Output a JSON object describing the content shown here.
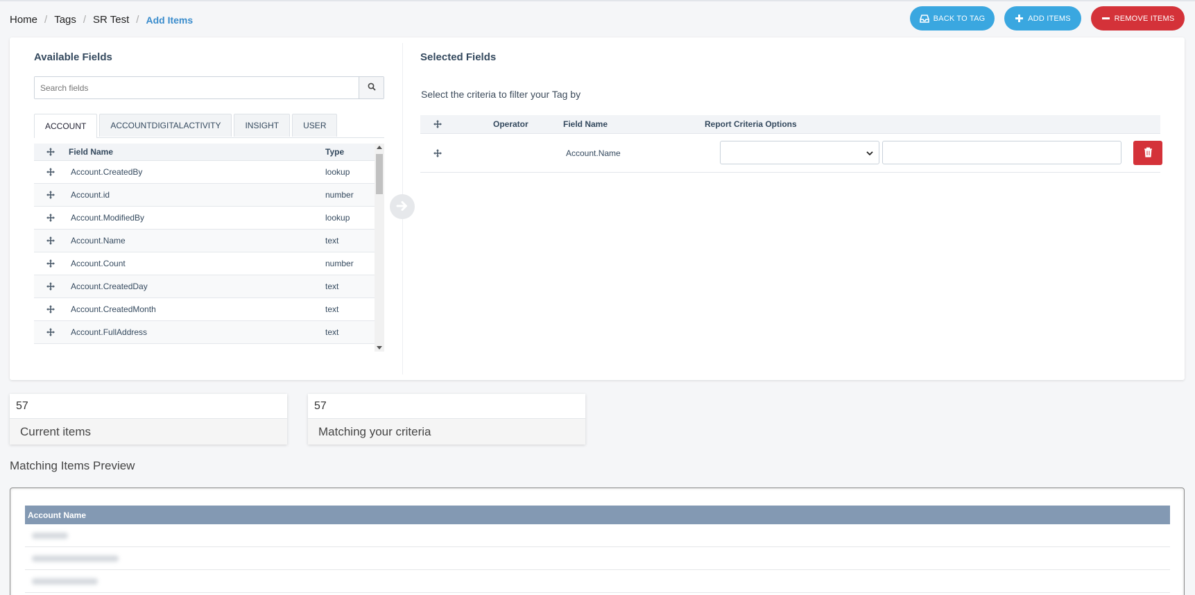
{
  "breadcrumb": [
    "Home",
    "Tags",
    "SR Test",
    "Add Items"
  ],
  "buttons": {
    "back": "BACK TO TAG",
    "add": "ADD ITEMS",
    "remove": "REMOVE ITEMS"
  },
  "available": {
    "title": "Available Fields",
    "search_placeholder": "Search fields",
    "tabs": [
      "ACCOUNT",
      "ACCOUNTDIGITALACTIVITY",
      "INSIGHT",
      "USER"
    ],
    "columns": {
      "name": "Field Name",
      "type": "Type"
    },
    "rows": [
      {
        "name": "Account.CreatedBy",
        "type": "lookup"
      },
      {
        "name": "Account.id",
        "type": "number"
      },
      {
        "name": "Account.ModifiedBy",
        "type": "lookup"
      },
      {
        "name": "Account.Name",
        "type": "text"
      },
      {
        "name": "Account.Count",
        "type": "number"
      },
      {
        "name": "Account.CreatedDay",
        "type": "text"
      },
      {
        "name": "Account.CreatedMonth",
        "type": "text"
      },
      {
        "name": "Account.FullAddress",
        "type": "text"
      }
    ]
  },
  "selected": {
    "title": "Selected Fields",
    "subtitle": "Select the criteria to filter your Tag by",
    "columns": {
      "operator": "Operator",
      "field": "Field Name",
      "criteria": "Report Criteria Options"
    },
    "rows": [
      {
        "operator": "",
        "field": "Account.Name",
        "criteria_select": "",
        "criteria_value": ""
      }
    ]
  },
  "stats": [
    {
      "value": "57",
      "label": "Current items"
    },
    {
      "value": "57",
      "label": "Matching your criteria"
    }
  ],
  "preview": {
    "title": "Matching Items Preview",
    "column": "Account Name"
  },
  "colors": {
    "accent": "#3aa7e0",
    "danger": "#d43239",
    "table_header": "#8399b3"
  }
}
